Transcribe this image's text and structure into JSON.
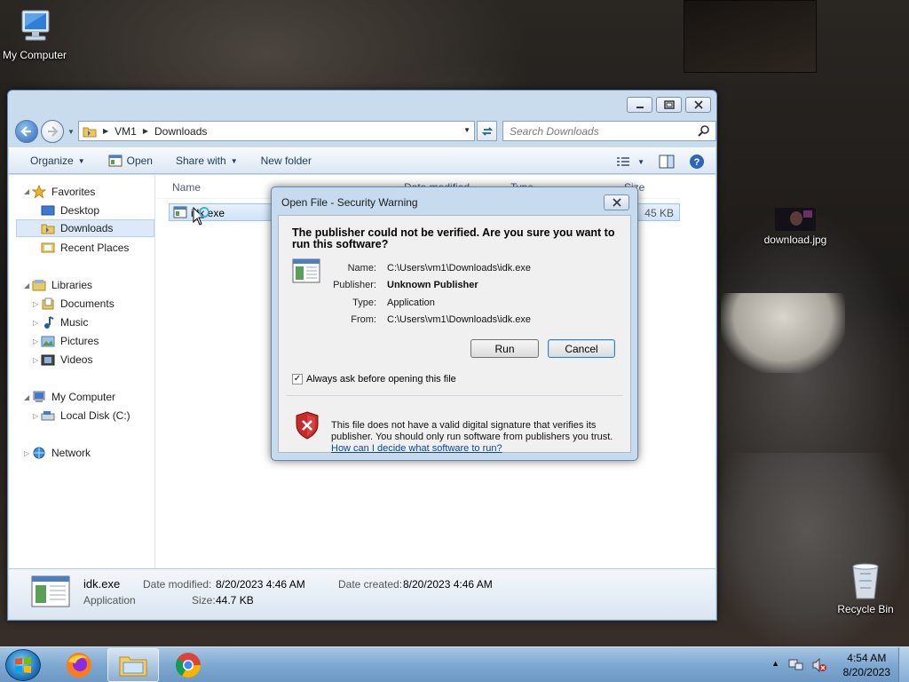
{
  "desktop": {
    "icons": [
      {
        "label": "My Computer"
      },
      {
        "label": "download.jpg"
      },
      {
        "label": "Recycle Bin"
      }
    ]
  },
  "explorer": {
    "breadcrumb": [
      "VM1",
      "Downloads"
    ],
    "search_placeholder": "Search Downloads",
    "toolbar": {
      "organize": "Organize",
      "open": "Open",
      "share_with": "Share with",
      "new_folder": "New folder"
    },
    "nav": {
      "favorites": "Favorites",
      "desktop": "Desktop",
      "downloads": "Downloads",
      "recent_places": "Recent Places",
      "libraries": "Libraries",
      "documents": "Documents",
      "music": "Music",
      "pictures": "Pictures",
      "videos": "Videos",
      "my_computer": "My Computer",
      "local_disk": "Local Disk (C:)",
      "network": "Network"
    },
    "columns": {
      "name": "Name",
      "date_modified": "Date modified",
      "type": "Type",
      "size": "Size"
    },
    "file": {
      "name": "idk.exe",
      "size": "45 KB"
    },
    "details": {
      "name": "idk.exe",
      "type": "Application",
      "date_modified_label": "Date modified:",
      "date_modified": "8/20/2023 4:46 AM",
      "size_label": "Size:",
      "size": "44.7 KB",
      "date_created_label": "Date created:",
      "date_created": "8/20/2023 4:46 AM"
    }
  },
  "dialog": {
    "title": "Open File - Security Warning",
    "heading": "The publisher could not be verified.  Are you sure you want to run this software?",
    "fields": [
      {
        "label": "Name:",
        "value": "C:\\Users\\vm1\\Downloads\\idk.exe"
      },
      {
        "label": "Publisher:",
        "value": "Unknown Publisher"
      },
      {
        "label": "Type:",
        "value": "Application"
      },
      {
        "label": "From:",
        "value": "C:\\Users\\vm1\\Downloads\\idk.exe"
      }
    ],
    "run_label": "Run",
    "cancel_label": "Cancel",
    "checkbox_label": "Always ask before opening this file",
    "checkbox_checked": true,
    "warning_text": "This file does not have a valid digital signature that verifies its publisher.  You should only run software from publishers you trust.",
    "help_link": "How can I decide what software to run?"
  },
  "taskbar": {
    "apps": [
      "firefox-icon",
      "file-explorer-icon",
      "chrome-icon"
    ],
    "time": "4:54 AM",
    "date": "8/20/2023"
  }
}
